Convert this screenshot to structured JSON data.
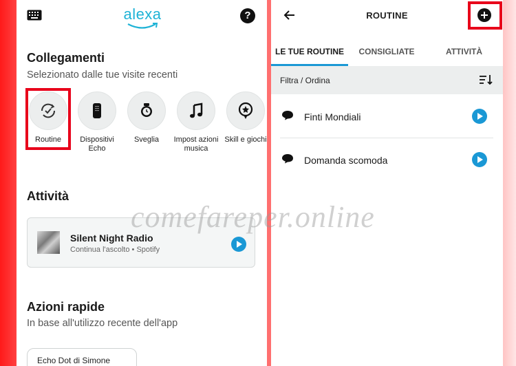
{
  "left": {
    "brand": "alexa",
    "help_label": "?",
    "shortcuts_title": "Collegamenti",
    "shortcuts_subtitle": "Selezionato dalle tue visite recenti",
    "shortcuts": [
      {
        "label": "Routine",
        "icon": "routine-check-icon"
      },
      {
        "label": "Dispositivi Echo",
        "icon": "echo-device-icon"
      },
      {
        "label": "Sveglia",
        "icon": "alarm-clock-icon"
      },
      {
        "label": "Impost azioni musica",
        "icon": "music-note-icon"
      },
      {
        "label": "Skill e giochi",
        "icon": "skill-badge-icon"
      }
    ],
    "activity_title": "Attività",
    "activity": {
      "title": "Silent Night Radio",
      "subtitle": "Continua l'ascolto • Spotify"
    },
    "quick_title": "Azioni rapide",
    "quick_subtitle": "In base all'utilizzo recente dell'app",
    "quick_chip": "Echo Dot di Simone"
  },
  "right": {
    "title": "ROUTINE",
    "tabs": [
      "LE TUE ROUTINE",
      "CONSIGLIATE",
      "ATTIVITÀ"
    ],
    "active_tab": "LE TUE ROUTINE",
    "filter_label": "Filtra / Ordina",
    "routines": [
      {
        "name": "Finti Mondiali"
      },
      {
        "name": "Domanda scomoda"
      }
    ]
  },
  "watermark": "comefareper.online",
  "colors": {
    "accent": "#1a98d5",
    "brand": "#1fb3d6",
    "highlight": "#e8001a"
  }
}
